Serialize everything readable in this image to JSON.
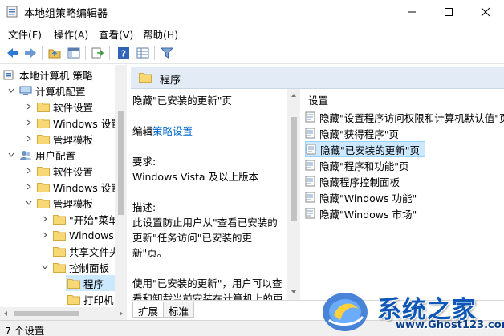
{
  "window": {
    "title": "本地组策略编辑器",
    "controls": [
      "minimize",
      "maximize",
      "close"
    ]
  },
  "menu": [
    "文件(F)",
    "操作(A)",
    "查看(V)",
    "帮助(H)"
  ],
  "toolbar": [
    "back-icon",
    "forward-icon",
    "up-folder-icon",
    "show-hide-tree-icon",
    "export-icon",
    "help-icon",
    "view-icon",
    "filter-icon"
  ],
  "tree": {
    "root": "本地计算机 策略",
    "items": [
      {
        "label": "计算机配置",
        "level": 1,
        "expanded": true
      },
      {
        "label": "软件设置",
        "level": 2,
        "expanded": false
      },
      {
        "label": "Windows 设置",
        "level": 2,
        "expanded": false
      },
      {
        "label": "管理模板",
        "level": 2,
        "expanded": false
      },
      {
        "label": "用户配置",
        "level": 1,
        "expanded": true
      },
      {
        "label": "软件设置",
        "level": 2,
        "expanded": false
      },
      {
        "label": "Windows 设置",
        "level": 2,
        "expanded": false
      },
      {
        "label": "管理模板",
        "level": 2,
        "expanded": true
      },
      {
        "label": "\"开始\"菜单",
        "level": 3,
        "expanded": false
      },
      {
        "label": "Windows",
        "level": 3,
        "expanded": false
      },
      {
        "label": "共享文件夹",
        "level": 3,
        "expanded": false
      },
      {
        "label": "控制面板",
        "level": 3,
        "expanded": true
      },
      {
        "label": "程序",
        "level": 4,
        "selected": true
      },
      {
        "label": "打印机",
        "level": 4
      }
    ]
  },
  "pane": {
    "header": "程序",
    "description": {
      "title": "隐藏\"已安装的更新\"页",
      "edit_prefix": "编辑",
      "edit_link": "策略设置",
      "req_label": "要求:",
      "req_value": "Windows Vista 及以上版本",
      "desc_label": "描述:",
      "desc_text": "此设置防止用户从\"查看已安装的更新\"任务访问\"已安装的更新\"页。",
      "desc_text2": "使用\"已安装的更新\"，用户可以查看和卸载当前安装在计算机上的更新。通常可以直接从 Windows Update 或各个程序发行者处下载"
    },
    "list_header": "设置",
    "settings": [
      "隐藏\"设置程序访问权限和计算机默认值\"页",
      "隐藏\"获得程序\"页",
      "隐藏\"已安装的更新\"页",
      "隐藏\"程序和功能\"页",
      "隐藏程序控制面板",
      "隐藏\"Windows 功能\"",
      "隐藏\"Windows 市场\""
    ],
    "selected_index": 2
  },
  "tabs": [
    "扩展",
    "标准"
  ],
  "status": "7 个设置",
  "watermark": {
    "text": "系统之家",
    "url": "www.Ghost123.com"
  },
  "colors": {
    "selection": "#cce8ff",
    "header": "#e3ecf6",
    "link": "#0066cc",
    "watermark": "#0d57b8"
  }
}
